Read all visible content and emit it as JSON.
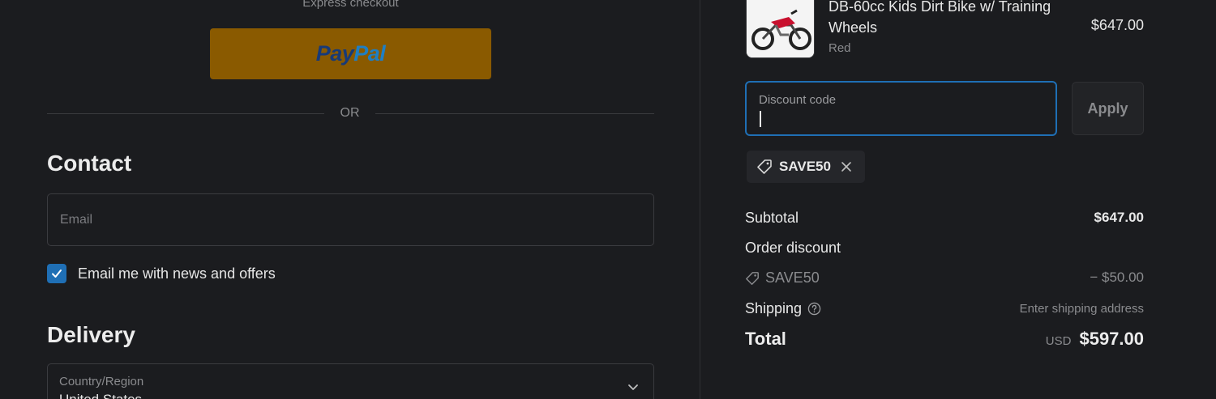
{
  "express": {
    "label": "Express checkout",
    "paypal_brand_left": "Pay",
    "paypal_brand_right": "Pal"
  },
  "divider": {
    "or_text": "OR"
  },
  "contact": {
    "heading": "Contact",
    "email_placeholder": "Email",
    "newsletter_label": "Email me with news and offers",
    "newsletter_checked": true
  },
  "delivery": {
    "heading": "Delivery",
    "country_label": "Country/Region",
    "country_value": "United States"
  },
  "product": {
    "name": "DB-60cc Kids Dirt Bike w/ Training Wheels",
    "variant": "Red",
    "price": "$647.00"
  },
  "discount": {
    "label": "Discount code",
    "apply_label": "Apply",
    "applied_code": "SAVE50"
  },
  "summary": {
    "subtotal_label": "Subtotal",
    "subtotal_value": "$647.00",
    "order_discount_label": "Order discount",
    "discount_code": "SAVE50",
    "discount_value": "− $50.00",
    "shipping_label": "Shipping",
    "shipping_value": "Enter shipping address",
    "total_label": "Total",
    "currency": "USD",
    "total_value": "$597.00"
  },
  "colors": {
    "accent": "#1f6fb5",
    "paypal_button": "#8a5a00",
    "background": "#1b1c1f"
  },
  "icons": {
    "tag": "tag-icon",
    "close": "close-icon",
    "help": "help-circle-icon",
    "chevron": "chevron-down-icon",
    "check": "checkmark-icon"
  }
}
